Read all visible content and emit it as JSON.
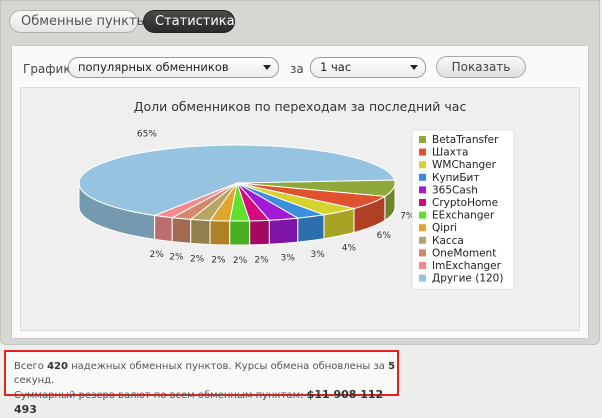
{
  "tabs": [
    {
      "label": "Обменные пункты",
      "active": false
    },
    {
      "label": "Статистика",
      "active": true
    }
  ],
  "controls": {
    "graph_label": "График",
    "graph_select": "популярных обменников",
    "for_label": "за",
    "period_select": "1 час",
    "show_button": "Показать"
  },
  "chart_data": {
    "type": "pie",
    "title": "Доли обменников по переходам за последний час",
    "series": [
      {
        "name": "BetaTransfer",
        "value": 7,
        "label": "7%",
        "color": "#8ea83a"
      },
      {
        "name": "Шахта",
        "value": 6,
        "label": "6%",
        "color": "#e0522e"
      },
      {
        "name": "WMChanger",
        "value": 4,
        "label": "4%",
        "color": "#d6d22e"
      },
      {
        "name": "КупиБит",
        "value": 3,
        "label": "3%",
        "color": "#3a8ede"
      },
      {
        "name": "365Cash",
        "value": 3,
        "label": "3%",
        "color": "#a21ad8"
      },
      {
        "name": "CryptoHome",
        "value": 2,
        "label": "2%",
        "color": "#d40a7c"
      },
      {
        "name": "EExchanger",
        "value": 2,
        "label": "2%",
        "color": "#5ee02c"
      },
      {
        "name": "Qipri",
        "value": 2,
        "label": "2%",
        "color": "#e0a62e"
      },
      {
        "name": "Касса",
        "value": 2,
        "label": "2%",
        "color": "#b8a462"
      },
      {
        "name": "OneMoment",
        "value": 2,
        "label": "2%",
        "color": "#d2886a"
      },
      {
        "name": "ImExchanger",
        "value": 2,
        "label": "2%",
        "color": "#f28c8c"
      },
      {
        "name": "Другие (120)",
        "value": 65,
        "label": "65%",
        "color": "#96c4e0"
      }
    ],
    "legend_position": "right"
  },
  "info": {
    "line1_prefix": "Всего",
    "count": "420",
    "line1_mid": "надежных обменных пунктов. Курсы обмена обновлены за",
    "seconds": "5",
    "line1_suffix": "секунд.",
    "line2_prefix": "Суммарный резерв валют по всем обменным пунктам:",
    "reserve": "$11 908 112 493"
  }
}
